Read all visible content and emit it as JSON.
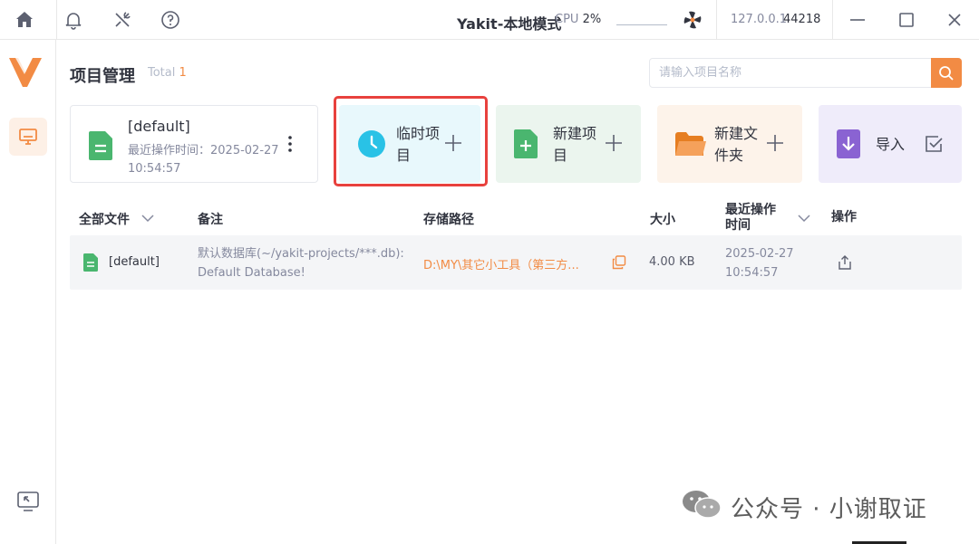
{
  "topbar": {
    "title": "Yakit-本地模式",
    "cpu_label": "CPU",
    "cpu_value": "2%",
    "address": "127.0.0.1",
    "port": "44218"
  },
  "main": {
    "page_title": "项目管理",
    "total_label": "Total",
    "total_count": "1",
    "search_placeholder": "请输入项目名称"
  },
  "cards": {
    "default": {
      "name": "[default]",
      "time": "最近操作时间：2025-02-27 10:54:57"
    },
    "temp": {
      "label": "临时项目"
    },
    "new_project": {
      "label": "新建项目"
    },
    "new_folder": {
      "label": "新建文件夹"
    },
    "import": {
      "label": "导入"
    }
  },
  "table": {
    "headers": {
      "all_files": "全部文件",
      "note": "备注",
      "path": "存储路径",
      "size": "大小",
      "recent": "最近操作时间",
      "actions": "操作"
    },
    "rows": [
      {
        "name": "[default]",
        "note": "默认数据库(~/yakit-projects/***.db): Default Database!",
        "path": "D:\\MY\\其它小工具（第三方...",
        "size": "4.00 KB",
        "date": "2025-02-27",
        "time": "10:54:57"
      }
    ]
  },
  "watermark": {
    "text": "公众号 · 小谢取证"
  },
  "colors": {
    "accent": "#f28b44",
    "highlight": "#e8413d",
    "temp_icon": "#29c2e6",
    "file_icon": "#4ab66f",
    "import_icon": "#8a63d2"
  }
}
